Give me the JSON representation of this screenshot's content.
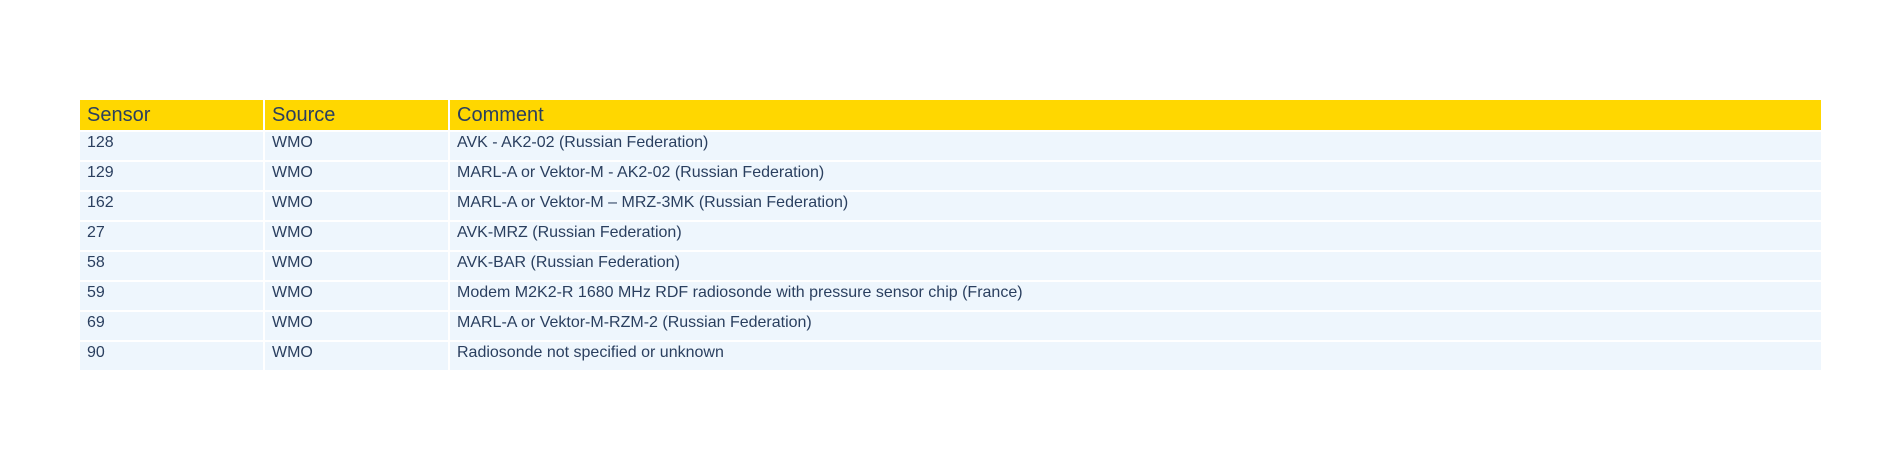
{
  "chart_data": {
    "type": "table",
    "columns": [
      "Sensor",
      "Source",
      "Comment"
    ],
    "header_fill": "#ffd700",
    "cell_fill": "#eef6fd",
    "font_color": "#2a3f5f",
    "rows": [
      [
        "128",
        "WMO",
        "AVK - AK2-02 (Russian Federation)"
      ],
      [
        "129",
        "WMO",
        "MARL-A or Vektor-M - AK2-02 (Russian Federation)"
      ],
      [
        "162",
        "WMO",
        "MARL-A or Vektor-M – MRZ-3MK (Russian Federation)"
      ],
      [
        "27",
        "WMO",
        "AVK-MRZ (Russian Federation)"
      ],
      [
        "58",
        "WMO",
        "AVK-BAR (Russian Federation)"
      ],
      [
        "59",
        "WMO",
        "Modem M2K2-R 1680 MHz RDF radiosonde with pressure sensor chip (France)"
      ],
      [
        "69",
        "WMO",
        "MARL-A or Vektor-M-RZM-2 (Russian Federation)"
      ],
      [
        "90",
        "WMO",
        "Radiosonde not specified or unknown"
      ]
    ]
  }
}
